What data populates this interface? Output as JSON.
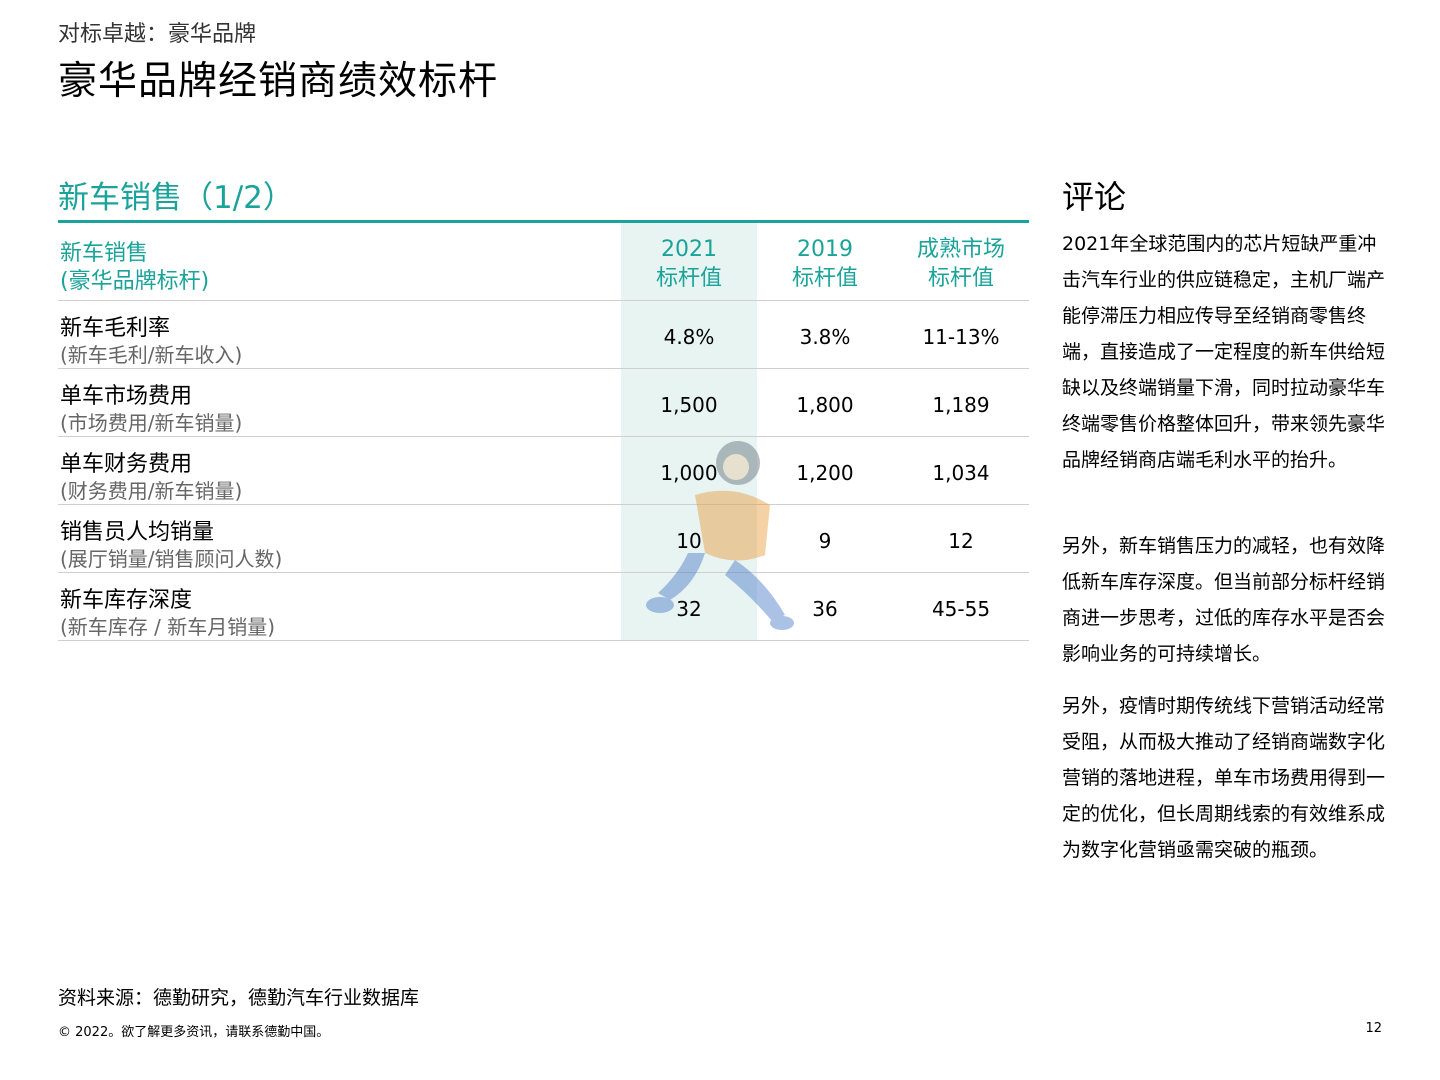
{
  "header": {
    "subtitle": "对标卓越：豪华品牌",
    "title": "豪华品牌经销商绩效标杆"
  },
  "section": {
    "title": "新车销售（1/2）"
  },
  "table": {
    "header": {
      "label": "新车销售",
      "sublabel": "(豪华品牌标杆)",
      "columns": [
        {
          "line1": "2021",
          "line2": "标杆值"
        },
        {
          "line1": "2019",
          "line2": "标杆值"
        },
        {
          "line1": "成熟市场",
          "line2": "标杆值"
        }
      ]
    },
    "rows": [
      {
        "label": "新车毛利率",
        "sublabel": "(新车毛利/新车收入)",
        "values": [
          "4.8%",
          "3.8%",
          "11-13%"
        ]
      },
      {
        "label": "单车市场费用",
        "sublabel": "(市场费用/新车销量)",
        "values": [
          "1,500",
          "1,800",
          "1,189"
        ]
      },
      {
        "label": "单车财务费用",
        "sublabel": "(财务费用/新车销量)",
        "values": [
          "1,000",
          "1,200",
          "1,034"
        ]
      },
      {
        "label": "销售员人均销量",
        "sublabel": "(展厅销量/销售顾问人数)",
        "values": [
          "10",
          "9",
          "12"
        ]
      },
      {
        "label": "新车库存深度",
        "sublabel": "(新车库存 / 新车月销量)",
        "values": [
          "32",
          "36",
          "45-55"
        ]
      }
    ]
  },
  "comments": {
    "title": "评论",
    "paragraphs": [
      "2021年全球范围内的芯片短缺严重冲击汽车行业的供应链稳定，主机厂端产能停滞压力相应传导至经销商零售终端，直接造成了一定程度的新车供给短缺以及终端销量下滑，同时拉动豪华车终端零售价格整体回升，带来领先豪华品牌经销商店端毛利水平的抬升。",
      "另外，新车销售压力的减轻，也有效降低新车库存深度。但当前部分标杆经销商进一步思考，过低的库存水平是否会影响业务的可持续增长。",
      "另外，疫情时期传统线下营销活动经常受阻，从而极大推动了经销商端数字化营销的落地进程，单车市场费用得到一定的优化，但长周期线索的有效维系成为数字化营销亟需突破的瓶颈。"
    ]
  },
  "footer": {
    "source": "资料来源：德勤研究，德勤汽车行业数据库",
    "copyright": "© 2022。欲了解更多资讯，请联系德勤中国。",
    "page_number": "12"
  },
  "colors": {
    "accent": "#1aa39a",
    "highlight": "#e7f4f1",
    "rule": "#cfcfcf"
  }
}
